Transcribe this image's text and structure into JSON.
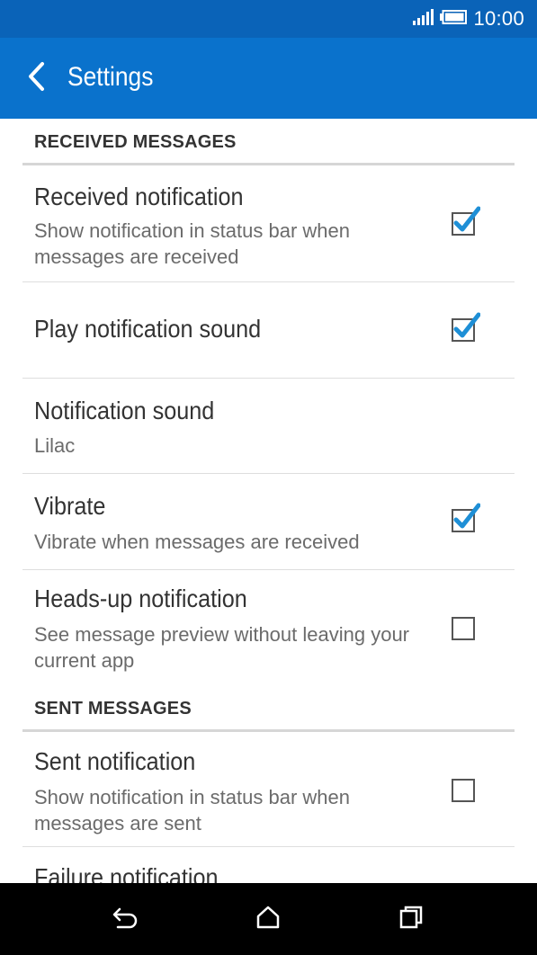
{
  "status_bar": {
    "time": "10:00",
    "icons": [
      "signal-icon",
      "battery-icon"
    ]
  },
  "app_bar": {
    "title": "Settings",
    "back_icon": "chevron-left-icon"
  },
  "sections": {
    "received": {
      "header": "RECEIVED MESSAGES",
      "items": [
        {
          "title": "Received notification",
          "subtitle": "Show notification in status bar when messages are received",
          "checked": true
        },
        {
          "title": "Play notification sound",
          "checked": true
        },
        {
          "title": "Notification sound",
          "subtitle": "Lilac"
        },
        {
          "title": "Vibrate",
          "subtitle": "Vibrate when messages are received",
          "checked": true
        },
        {
          "title": "Heads-up notification",
          "subtitle": "See message preview without leaving your current app",
          "checked": false
        }
      ]
    },
    "sent": {
      "header": "SENT MESSAGES",
      "items": [
        {
          "title": "Sent notification",
          "subtitle": "Show notification in status bar when messages are sent",
          "checked": false
        },
        {
          "title": "Failure notification"
        }
      ]
    }
  },
  "nav_bar": {
    "icons": [
      "back-icon",
      "home-icon",
      "recents-icon"
    ]
  },
  "colors": {
    "status_bar": "#0a63b8",
    "app_bar": "#0a72cc",
    "check": "#1e8fd6"
  }
}
